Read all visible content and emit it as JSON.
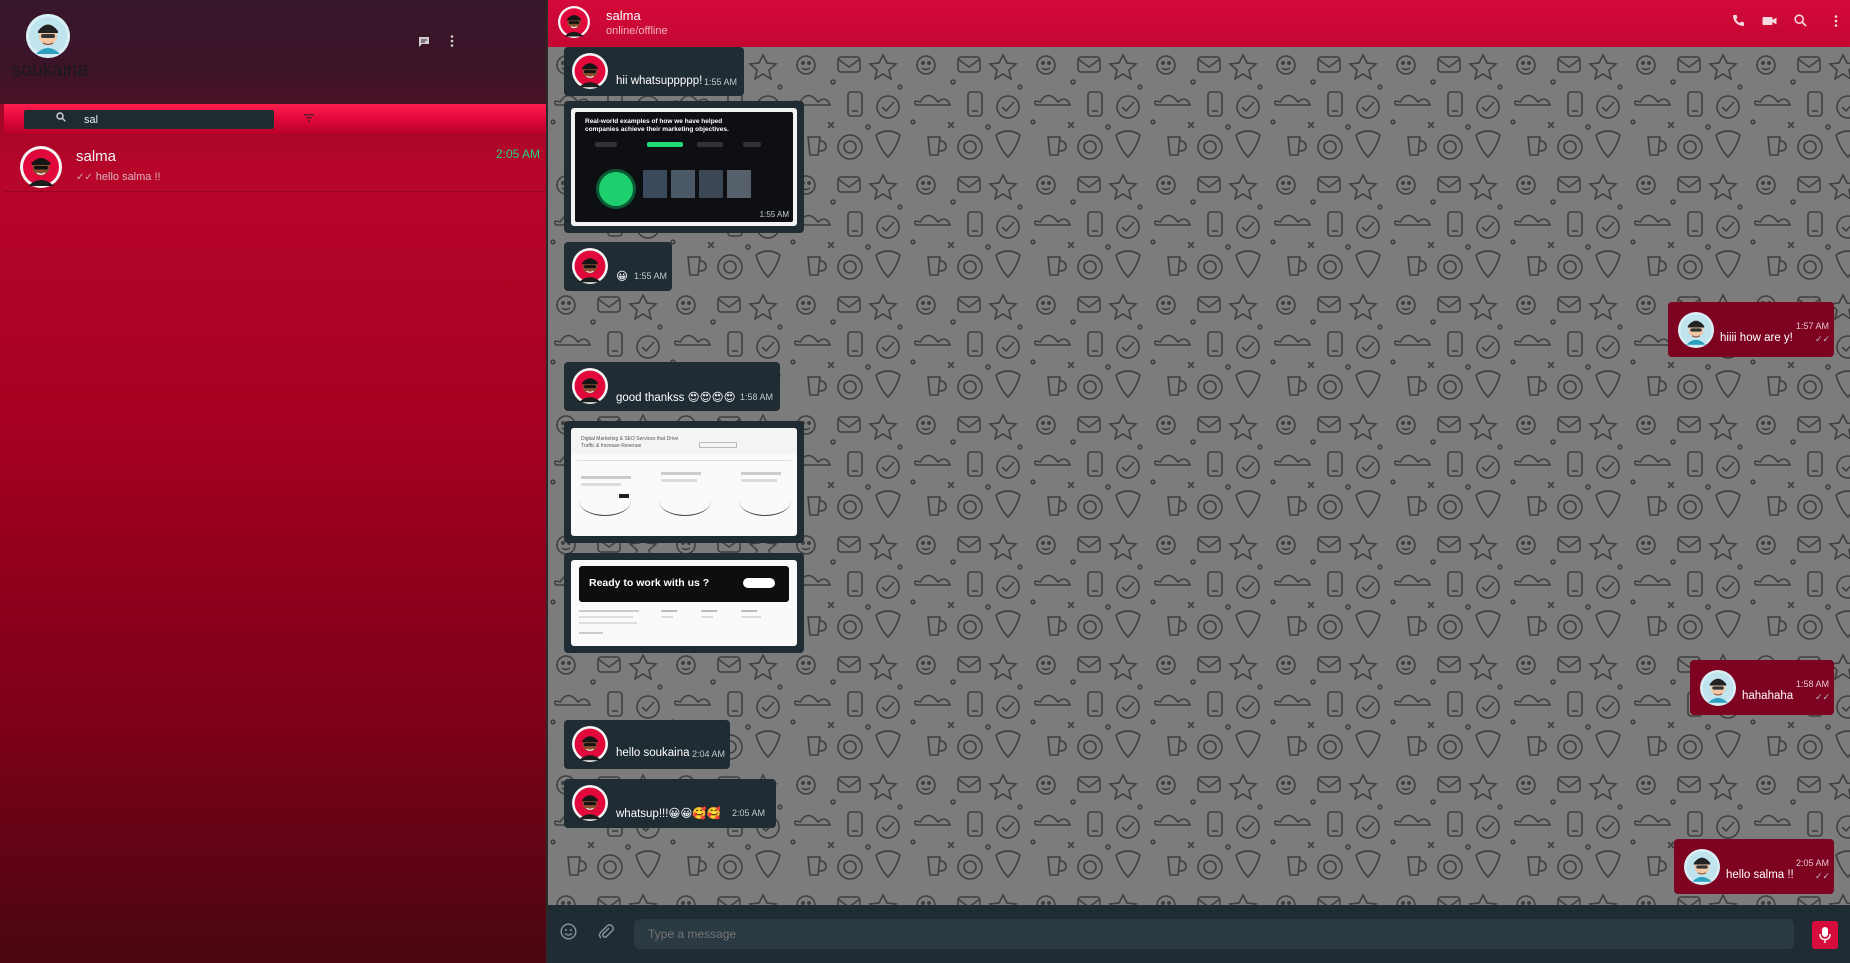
{
  "colors": {
    "accent": "#d3093a",
    "sidebar_top": "#3d1428",
    "incoming_bubble": "#1f2c33",
    "outgoing_bubble": "#7e0320",
    "conversation_bg": "#7c7c7c",
    "unread_time": "#1ed48a"
  },
  "sidebar": {
    "user_name": "soukaina",
    "icons": [
      "new-chat-icon",
      "menu-dots-icon"
    ],
    "search": {
      "value": "sal",
      "icon": "search-icon"
    },
    "filter_icon": "filter-icon",
    "chats": [
      {
        "name": "salma",
        "time": "2:05 AM",
        "last_message": "hello salma !!",
        "status_icon": "double-check-icon"
      }
    ]
  },
  "header": {
    "contact_name": "salma",
    "contact_status": "online/offline",
    "icons": [
      "phone-icon",
      "video-icon",
      "search-icon",
      "menu-dots-icon"
    ]
  },
  "messages": [
    {
      "id": "m1",
      "direction": "in",
      "type": "text",
      "text": "hii whatsuppppp!",
      "time": "1:55 AM"
    },
    {
      "id": "m2",
      "direction": "in",
      "type": "image",
      "time": "1:55 AM",
      "preview_title": "Real-world examples of how we have helped companies achieve their marketing objectives."
    },
    {
      "id": "m3",
      "direction": "in",
      "type": "text",
      "text": "😀",
      "time": "1:55 AM"
    },
    {
      "id": "m4",
      "direction": "out",
      "type": "text",
      "text": "hiiii how are y!",
      "time": "1:57 AM"
    },
    {
      "id": "m5",
      "direction": "in",
      "type": "text",
      "text": "good thankss 😍😍😍😍",
      "time": "1:58 AM"
    },
    {
      "id": "m6",
      "direction": "in",
      "type": "image",
      "preview_title": "Digital Marketing & SEO Services that Drive Traffic & Increase Revenue"
    },
    {
      "id": "m7",
      "direction": "in",
      "type": "image",
      "preview_title": "Ready to work with us ?"
    },
    {
      "id": "m8",
      "direction": "out",
      "type": "text",
      "text": "hahahaha",
      "time": "1:58 AM"
    },
    {
      "id": "m9",
      "direction": "in",
      "type": "text",
      "text": "hello soukaina",
      "time": "2:04 AM"
    },
    {
      "id": "m10",
      "direction": "in",
      "type": "text",
      "text": "whatsup!!!😀😀🥰🥰",
      "time": "2:05 AM"
    },
    {
      "id": "m11",
      "direction": "out",
      "type": "text",
      "text": "hello salma !!",
      "time": "2:05 AM"
    }
  ],
  "compose": {
    "placeholder": "Type a message",
    "icons": [
      "emoji-icon",
      "attach-icon",
      "microphone-icon"
    ]
  }
}
